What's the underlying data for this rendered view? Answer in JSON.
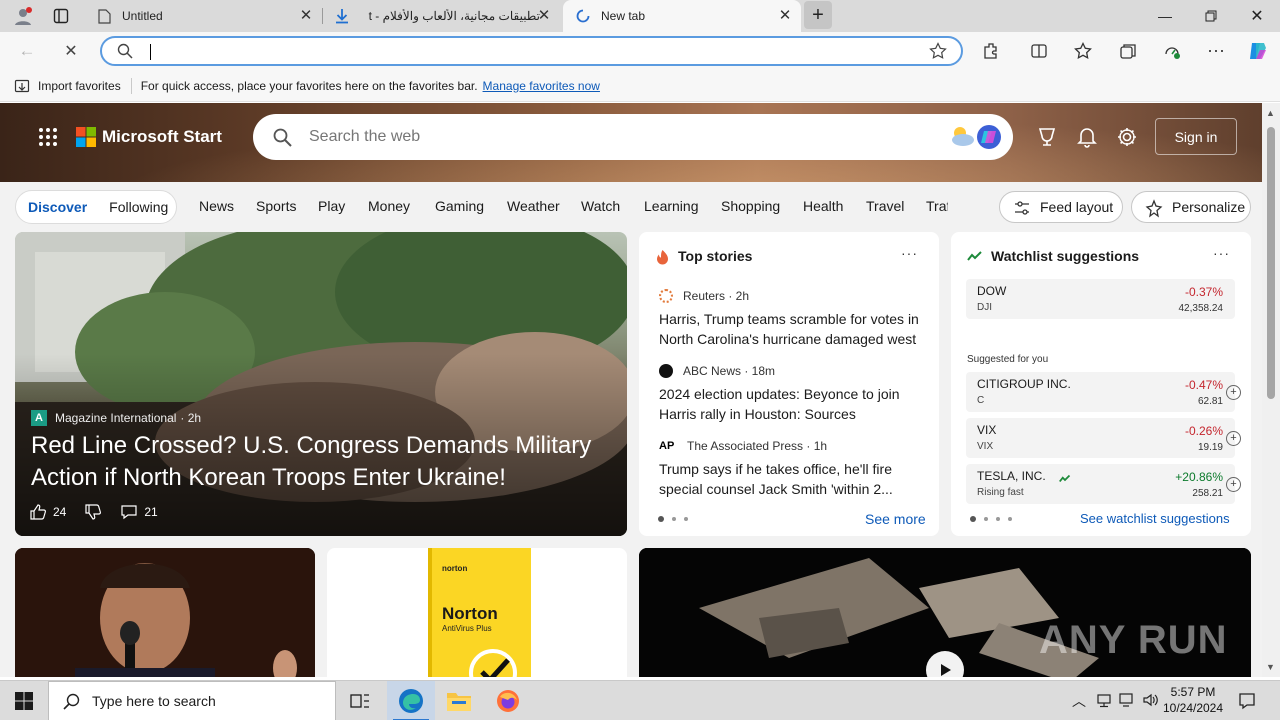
{
  "tabs": [
    {
      "title": "Untitled"
    },
    {
      "title": "تطبيقات مجانية، الألعاب والأفلام - t"
    },
    {
      "title": "New tab"
    }
  ],
  "address": {
    "value": "",
    "placeholder": ""
  },
  "favorites_bar": {
    "import_label": "Import favorites",
    "hint": "For quick access, place your favorites here on the favorites bar.",
    "manage_link": "Manage favorites now"
  },
  "msn": {
    "brand": "Microsoft Start",
    "search_placeholder": "Search the web",
    "signin": "Sign in",
    "pill_tabs": [
      "Discover",
      "Following"
    ],
    "nav": [
      "News",
      "Sports",
      "Play",
      "Money",
      "Gaming",
      "Weather",
      "Watch",
      "Learning",
      "Shopping",
      "Health",
      "Travel",
      "Traf"
    ],
    "feed_layout": "Feed layout",
    "personalize": "Personalize"
  },
  "hero_story": {
    "source": "Magazine International",
    "age": "· 2h",
    "headline": "Red Line Crossed? U.S. Congress Demands Military Action if North Korean Troops Enter Ukraine!",
    "likes": "24",
    "comments": "21"
  },
  "top_stories": {
    "title": "Top stories",
    "items": [
      {
        "source": "Reuters · 2h",
        "headline": "Harris, Trump teams scramble for votes in North Carolina's hurricane damaged west"
      },
      {
        "source": "ABC News · 18m",
        "headline": "2024 election updates: Beyonce to join Harris rally in Houston: Sources"
      },
      {
        "source": "The Associated Press · 1h",
        "headline": "Trump says if he takes office, he'll fire special counsel Jack Smith 'within 2..."
      }
    ],
    "see_more": "See more"
  },
  "watchlist": {
    "title": "Watchlist suggestions",
    "index": {
      "name": "DOW",
      "symbol": "DJI",
      "change": "-0.37%",
      "price": "42,358.24"
    },
    "suggested_label": "Suggested for you",
    "items": [
      {
        "name": "CITIGROUP INC.",
        "symbol": "C",
        "change": "-0.47%",
        "price": "62.81"
      },
      {
        "name": "VIX",
        "symbol": "VIX",
        "change": "-0.26%",
        "price": "19.19"
      },
      {
        "name": "TESLA, INC.",
        "symbol": "Rising fast",
        "change": "+20.86%",
        "price": "258.21"
      }
    ],
    "see_link": "See watchlist suggestions"
  },
  "promo": {
    "brand": "norton",
    "product": "Norton",
    "sub": "AntiVirus Plus"
  },
  "watermark": "ANY RUN",
  "taskbar": {
    "search_placeholder": "Type here to search",
    "time": "5:57 PM",
    "date": "10/24/2024"
  },
  "colors": {
    "accent": "#0e5ab8",
    "negative": "#c4262e",
    "positive": "#0c7a2c"
  }
}
